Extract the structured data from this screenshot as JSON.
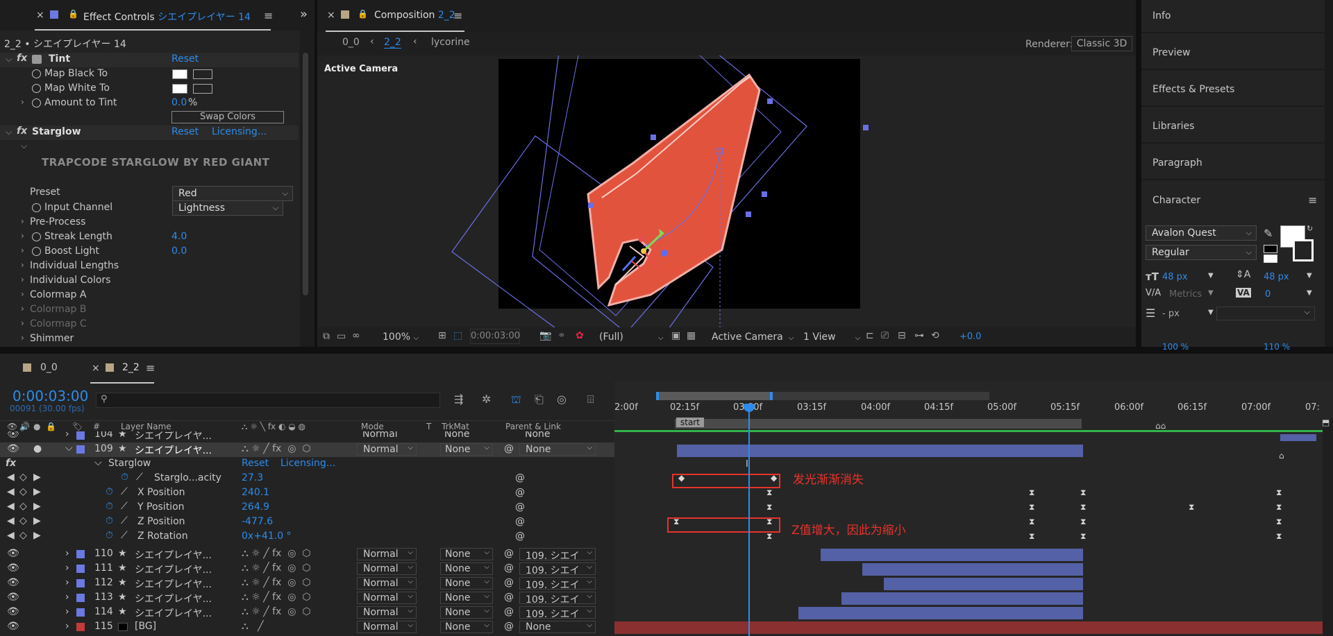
{
  "effect_controls": {
    "tab_prefix": "Effect Controls",
    "tab_layer": "シエイプレイヤー 14",
    "breadcrumb": "2_2 • シエイプレイヤー 14",
    "tint": {
      "name": "Tint",
      "reset": "Reset",
      "map_black": "Map Black To",
      "map_white": "Map White To",
      "amount_label": "Amount to Tint",
      "amount_value": "0.0",
      "amount_unit": "%",
      "swap": "Swap Colors"
    },
    "starglow": {
      "name": "Starglow",
      "reset": "Reset",
      "licensing": "Licensing...",
      "banner": "TRAPCODE STARGLOW BY RED GIANT",
      "preset_label": "Preset",
      "preset_value": "Red",
      "input_channel_label": "Input Channel",
      "input_channel_value": "Lightness",
      "preprocess": "Pre-Process",
      "streak_label": "Streak Length",
      "streak_value": "4.0",
      "boost_label": "Boost Light",
      "boost_value": "0.0",
      "ind_lengths": "Individual Lengths",
      "ind_colors": "Individual Colors",
      "colormap_a": "Colormap A",
      "colormap_b": "Colormap B",
      "colormap_c": "Colormap C",
      "shimmer": "Shimmer"
    }
  },
  "composition": {
    "tab_prefix": "Composition",
    "tab_name": "2_2",
    "crumb1": "0_0",
    "crumb2": "2_2",
    "crumb3": "lycorine",
    "renderer_label": "Renderer:",
    "renderer_value": "Classic 3D",
    "active_camera": "Active Camera",
    "zoom": "100%",
    "timecode": "0:00:03:00",
    "resolution": "(Full)",
    "camera": "Active Camera",
    "views": "1 View",
    "exposure": "+0.0"
  },
  "right_panel": {
    "items": [
      "Info",
      "Preview",
      "Effects & Presets",
      "Libraries",
      "Paragraph"
    ],
    "character_title": "Character",
    "font": "Avalon Quest",
    "style": "Regular",
    "size": "48 px",
    "leading": "48 px",
    "kerning": "Metrics",
    "tracking": "0",
    "stroke": "- px",
    "vscale": "100 %",
    "hscale": "110 %"
  },
  "timeline": {
    "tab1": "0_0",
    "tab2": "2_2",
    "timecode": "0:00:03:00",
    "frames": "00091 (30.00 fps)",
    "search_placeholder": "",
    "headers": {
      "layer_name": "Layer Name",
      "mode": "Mode",
      "t": "T",
      "trkmat": "TrkMat",
      "parent": "Parent & Link",
      "hash": "#"
    },
    "ruler": [
      "2:00f",
      "02:15f",
      "03:00f",
      "03:15f",
      "04:00f",
      "04:15f",
      "05:00f",
      "05:15f",
      "06:00f",
      "06:15f",
      "07:00f",
      "07:"
    ],
    "start_marker": "start",
    "layers_top": [
      {
        "num": "104",
        "name": "シエイプレイヤ...",
        "mode": "Normal",
        "trkmat": "None",
        "parent": "None"
      },
      {
        "num": "109",
        "name": "シエイプレイヤ...",
        "mode": "Normal",
        "trkmat": "None",
        "parent": "None"
      }
    ],
    "starglow": {
      "name": "Starglow",
      "reset": "Reset",
      "licensing": "Licensing..."
    },
    "props": [
      {
        "name": "Starglo...acity",
        "value": "27.3"
      },
      {
        "name": "X Position",
        "value": "240.1"
      },
      {
        "name": "Y Position",
        "value": "264.9"
      },
      {
        "name": "Z Position",
        "value": "-477.6"
      },
      {
        "name": "Z Rotation",
        "value": "0x+41.0 °"
      }
    ],
    "layers_bottom": [
      {
        "num": "110",
        "name": "シエイプレイヤ...",
        "mode": "Normal",
        "trkmat": "None",
        "parent": "109. シエイ"
      },
      {
        "num": "111",
        "name": "シエイプレイヤ...",
        "mode": "Normal",
        "trkmat": "None",
        "parent": "109. シエイ"
      },
      {
        "num": "112",
        "name": "シエイプレイヤ...",
        "mode": "Normal",
        "trkmat": "None",
        "parent": "109. シエイ"
      },
      {
        "num": "113",
        "name": "シエイプレイヤ...",
        "mode": "Normal",
        "trkmat": "None",
        "parent": "109. シエイ"
      },
      {
        "num": "114",
        "name": "シエイプレイヤ...",
        "mode": "Normal",
        "trkmat": "None",
        "parent": "109. シエイ"
      },
      {
        "num": "115",
        "name": "[BG]",
        "mode": "Normal",
        "trkmat": "None",
        "parent": "None"
      }
    ],
    "annotation1": "发光渐渐消失",
    "annotation2": "Z值增大，因此为缩小"
  },
  "colors": {
    "accent_blue": "#2d8ceb",
    "layer_label": "#6b79e0",
    "bg_label": "#c43a3a",
    "layer_bar": "#5461a6",
    "shape_fill": "#e2533d",
    "annotation": "#e8332a"
  }
}
